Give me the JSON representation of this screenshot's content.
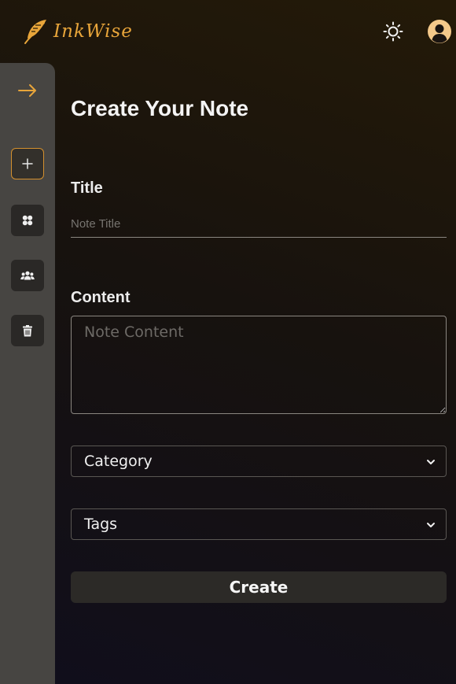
{
  "app": {
    "name": "InkWise",
    "logo_icon": "feather-icon",
    "brand_color": "#e8a53a"
  },
  "header": {
    "theme_toggle_icon": "sun-icon",
    "profile_icon": "user-circle-icon"
  },
  "sidebar": {
    "expand_icon": "arrow-right-icon",
    "items": [
      {
        "icon": "plus-icon",
        "active": true
      },
      {
        "icon": "grid-dots-icon",
        "active": false
      },
      {
        "icon": "users-icon",
        "active": false
      },
      {
        "icon": "trash-icon",
        "active": false
      }
    ]
  },
  "form": {
    "heading": "Create Your Note",
    "title_label": "Title",
    "title_placeholder": "Note Title",
    "title_value": "",
    "content_label": "Content",
    "content_placeholder": "Note Content",
    "content_value": "",
    "category_selected": "Category",
    "tags_selected": "Tags",
    "submit_label": "Create"
  }
}
